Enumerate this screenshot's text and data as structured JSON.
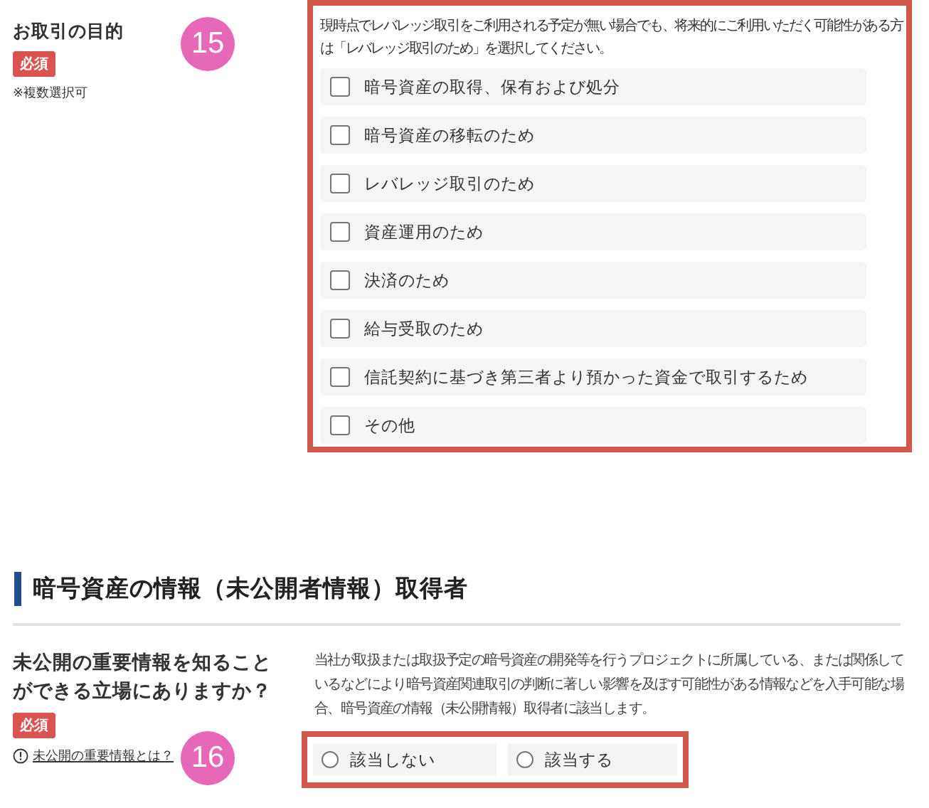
{
  "purpose": {
    "label": "お取引の目的",
    "required": "必須",
    "note": "※複数選択可",
    "annotation": "15",
    "hint": "現時点でレバレッジ取引をご利用される予定が無い場合でも、将来的にご利用いただく可能性がある方は「レバレッジ取引のため」を選択してください。",
    "options": [
      {
        "label": "暗号資産の取得、保有および処分",
        "checked": false
      },
      {
        "label": "暗号資産の移転のため",
        "checked": false
      },
      {
        "label": "レバレッジ取引のため",
        "checked": false
      },
      {
        "label": "資産運用のため",
        "checked": false
      },
      {
        "label": "決済のため",
        "checked": false
      },
      {
        "label": "給与受取のため",
        "checked": false
      },
      {
        "label": "信託契約に基づき第三者より預かった資金で取引するため",
        "checked": false
      },
      {
        "label": "その他",
        "checked": false
      }
    ]
  },
  "section": {
    "title": "暗号資産の情報（未公開者情報）取得者"
  },
  "insider": {
    "label": "未公開の重要情報を知ることができる立場にありますか？",
    "required": "必須",
    "help_link": "未公開の重要情報とは？",
    "annotation": "16",
    "description": "当社が取扱または取扱予定の暗号資産の開発等を行うプロジェクトに所属している、または関係しているなどにより暗号資産関連取引の判断に著しい影響を及ぼす可能性がある情報などを入手可能な場合、暗号資産の情報（未公開情報）取得者に該当します。",
    "options": [
      {
        "label": "該当しない",
        "selected": false
      },
      {
        "label": "該当する",
        "selected": false
      }
    ]
  }
}
